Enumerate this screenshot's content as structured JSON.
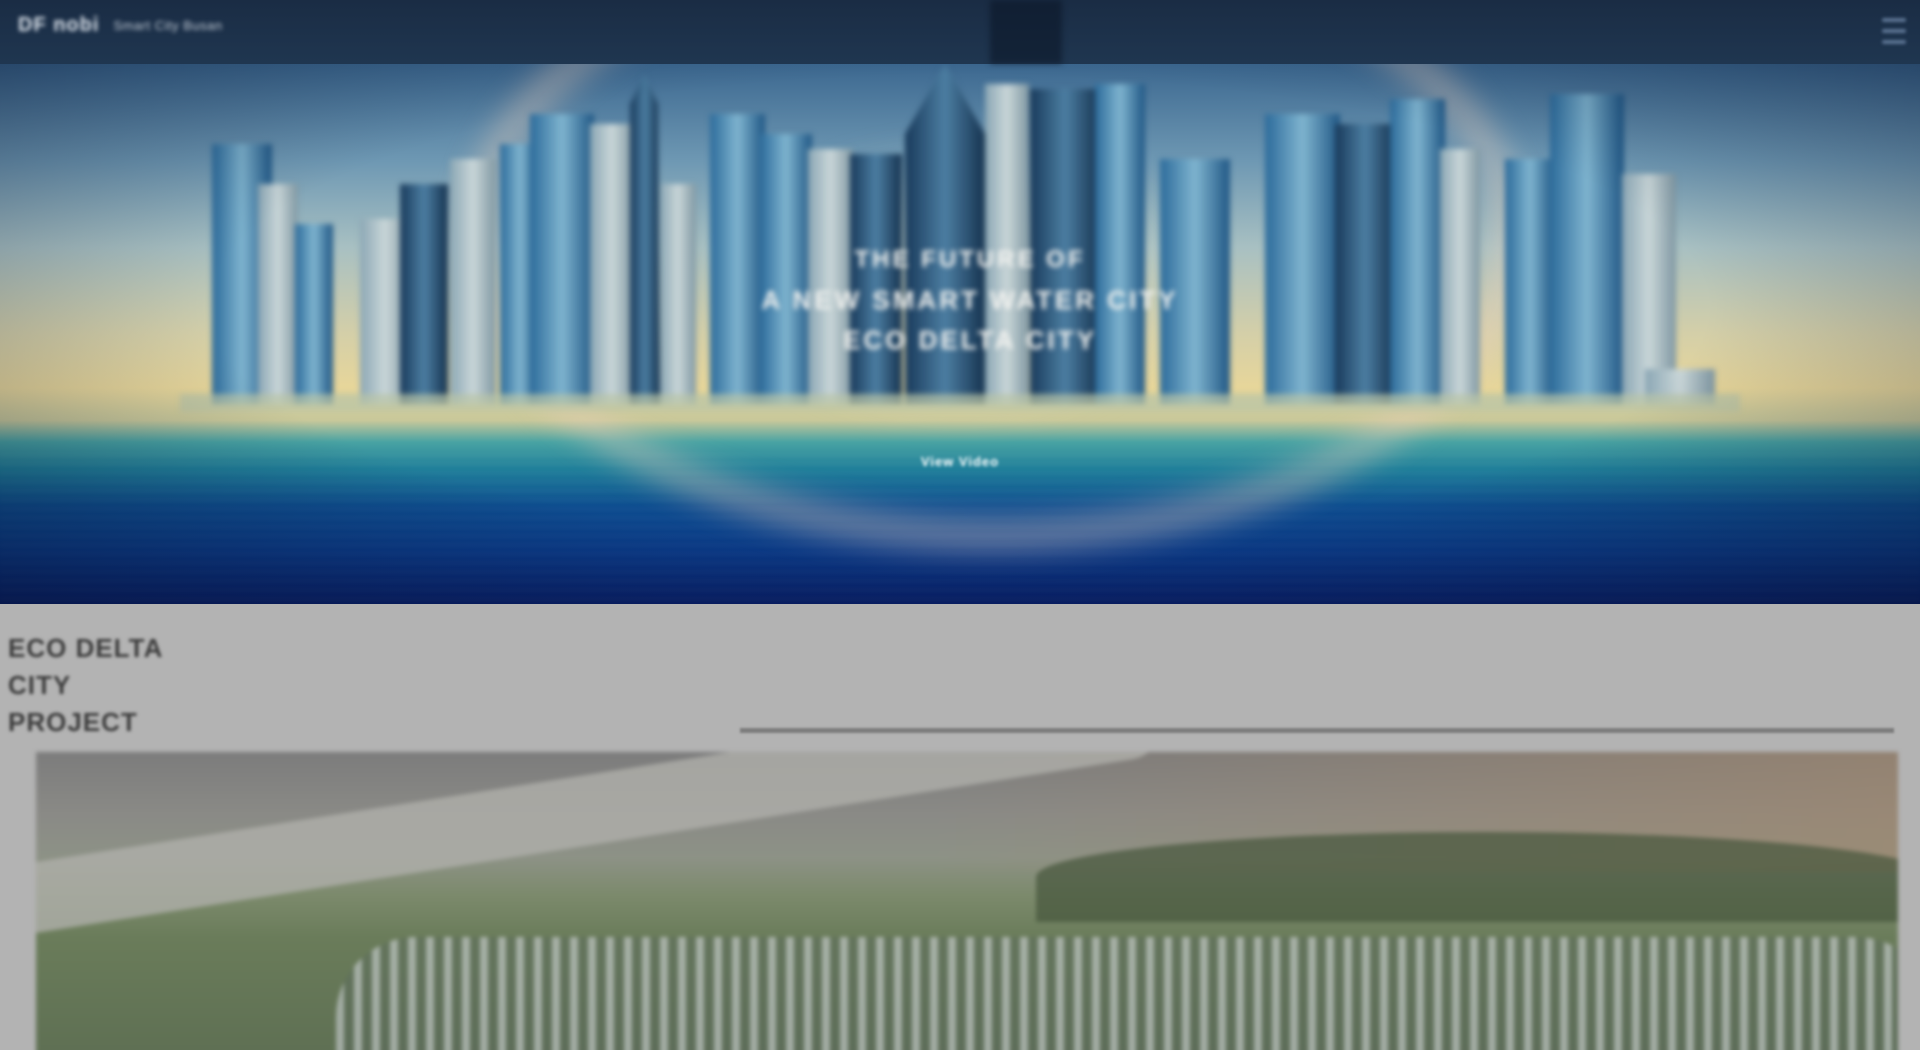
{
  "header": {
    "logo_text": "DF nobi",
    "logo_sub": "Smart City Busan",
    "menu_icon": "hamburger-menu-icon"
  },
  "hero": {
    "lines": [
      "THE FUTURE OF",
      "A NEW SMART WATER CITY",
      "ECO DELTA CITY"
    ],
    "cta_label": "View Video"
  },
  "project": {
    "title_lines": [
      "ECO DELTA",
      "CITY",
      "PROJECT"
    ]
  },
  "colors": {
    "header_bg": "#1a2c44",
    "section_bg": "#b3b3b3",
    "title_text": "#3d3d3d",
    "water_deep": "#0a3a88"
  }
}
